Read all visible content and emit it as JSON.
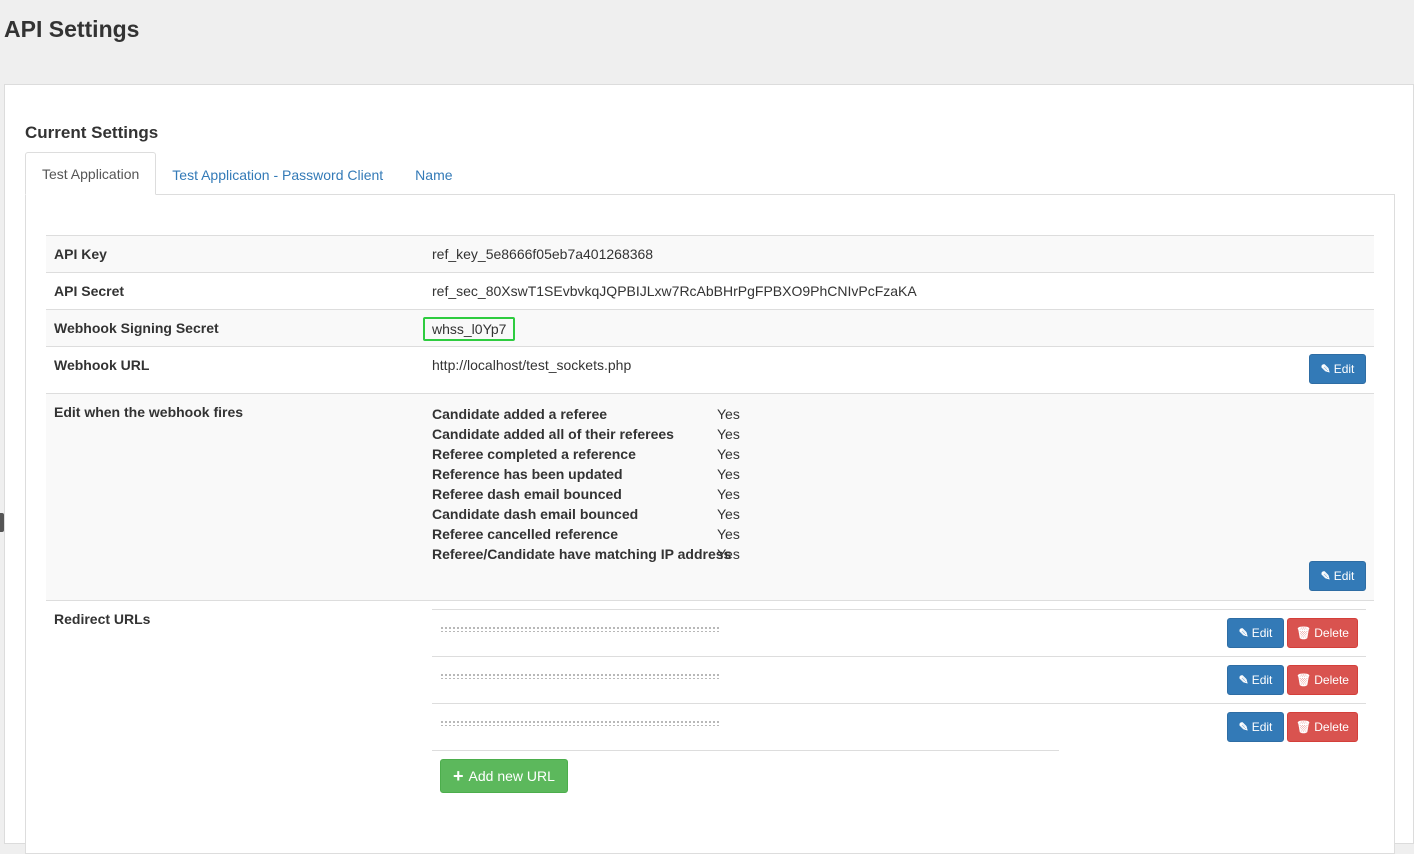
{
  "page": {
    "title": "API Settings"
  },
  "section": {
    "title": "Current Settings"
  },
  "tabs": [
    {
      "label": "Test Application"
    },
    {
      "label": "Test Application - Password Client"
    },
    {
      "label": "Name"
    }
  ],
  "settings": {
    "api_key": {
      "label": "API Key",
      "value": "ref_key_5e8666f05eb7a401268368"
    },
    "api_secret": {
      "label": "API Secret",
      "value": "ref_sec_80XswT1SEvbvkqJQPBIJLxw7RcAbBHrPgFPBXO9PhCNIvPcFzaKA"
    },
    "webhook_signing_secret": {
      "label": "Webhook Signing Secret",
      "value": "whss_l0Yp7"
    },
    "webhook_url": {
      "label": "Webhook URL",
      "value": "http://localhost/test_sockets.php",
      "edit_label": "Edit"
    },
    "webhook_fires": {
      "label": "Edit when the webhook fires",
      "edit_label": "Edit",
      "events": [
        {
          "name": "Candidate added a referee",
          "status": "Yes"
        },
        {
          "name": "Candidate added all of their referees",
          "status": "Yes"
        },
        {
          "name": "Referee completed a reference",
          "status": "Yes"
        },
        {
          "name": "Reference has been updated",
          "status": "Yes"
        },
        {
          "name": "Referee dash email bounced",
          "status": "Yes"
        },
        {
          "name": "Candidate dash email bounced",
          "status": "Yes"
        },
        {
          "name": "Referee cancelled reference",
          "status": "Yes"
        },
        {
          "name": "Referee/Candidate have matching IP address",
          "status": "Yes"
        }
      ]
    },
    "redirect_urls": {
      "label": "Redirect URLs",
      "edit_label": "Edit",
      "delete_label": "Delete",
      "add_label": "Add new URL"
    }
  },
  "colors": {
    "primary": "#337ab7",
    "danger": "#d9534f",
    "success": "#5cb85c",
    "highlight_border": "#2ecc40"
  }
}
